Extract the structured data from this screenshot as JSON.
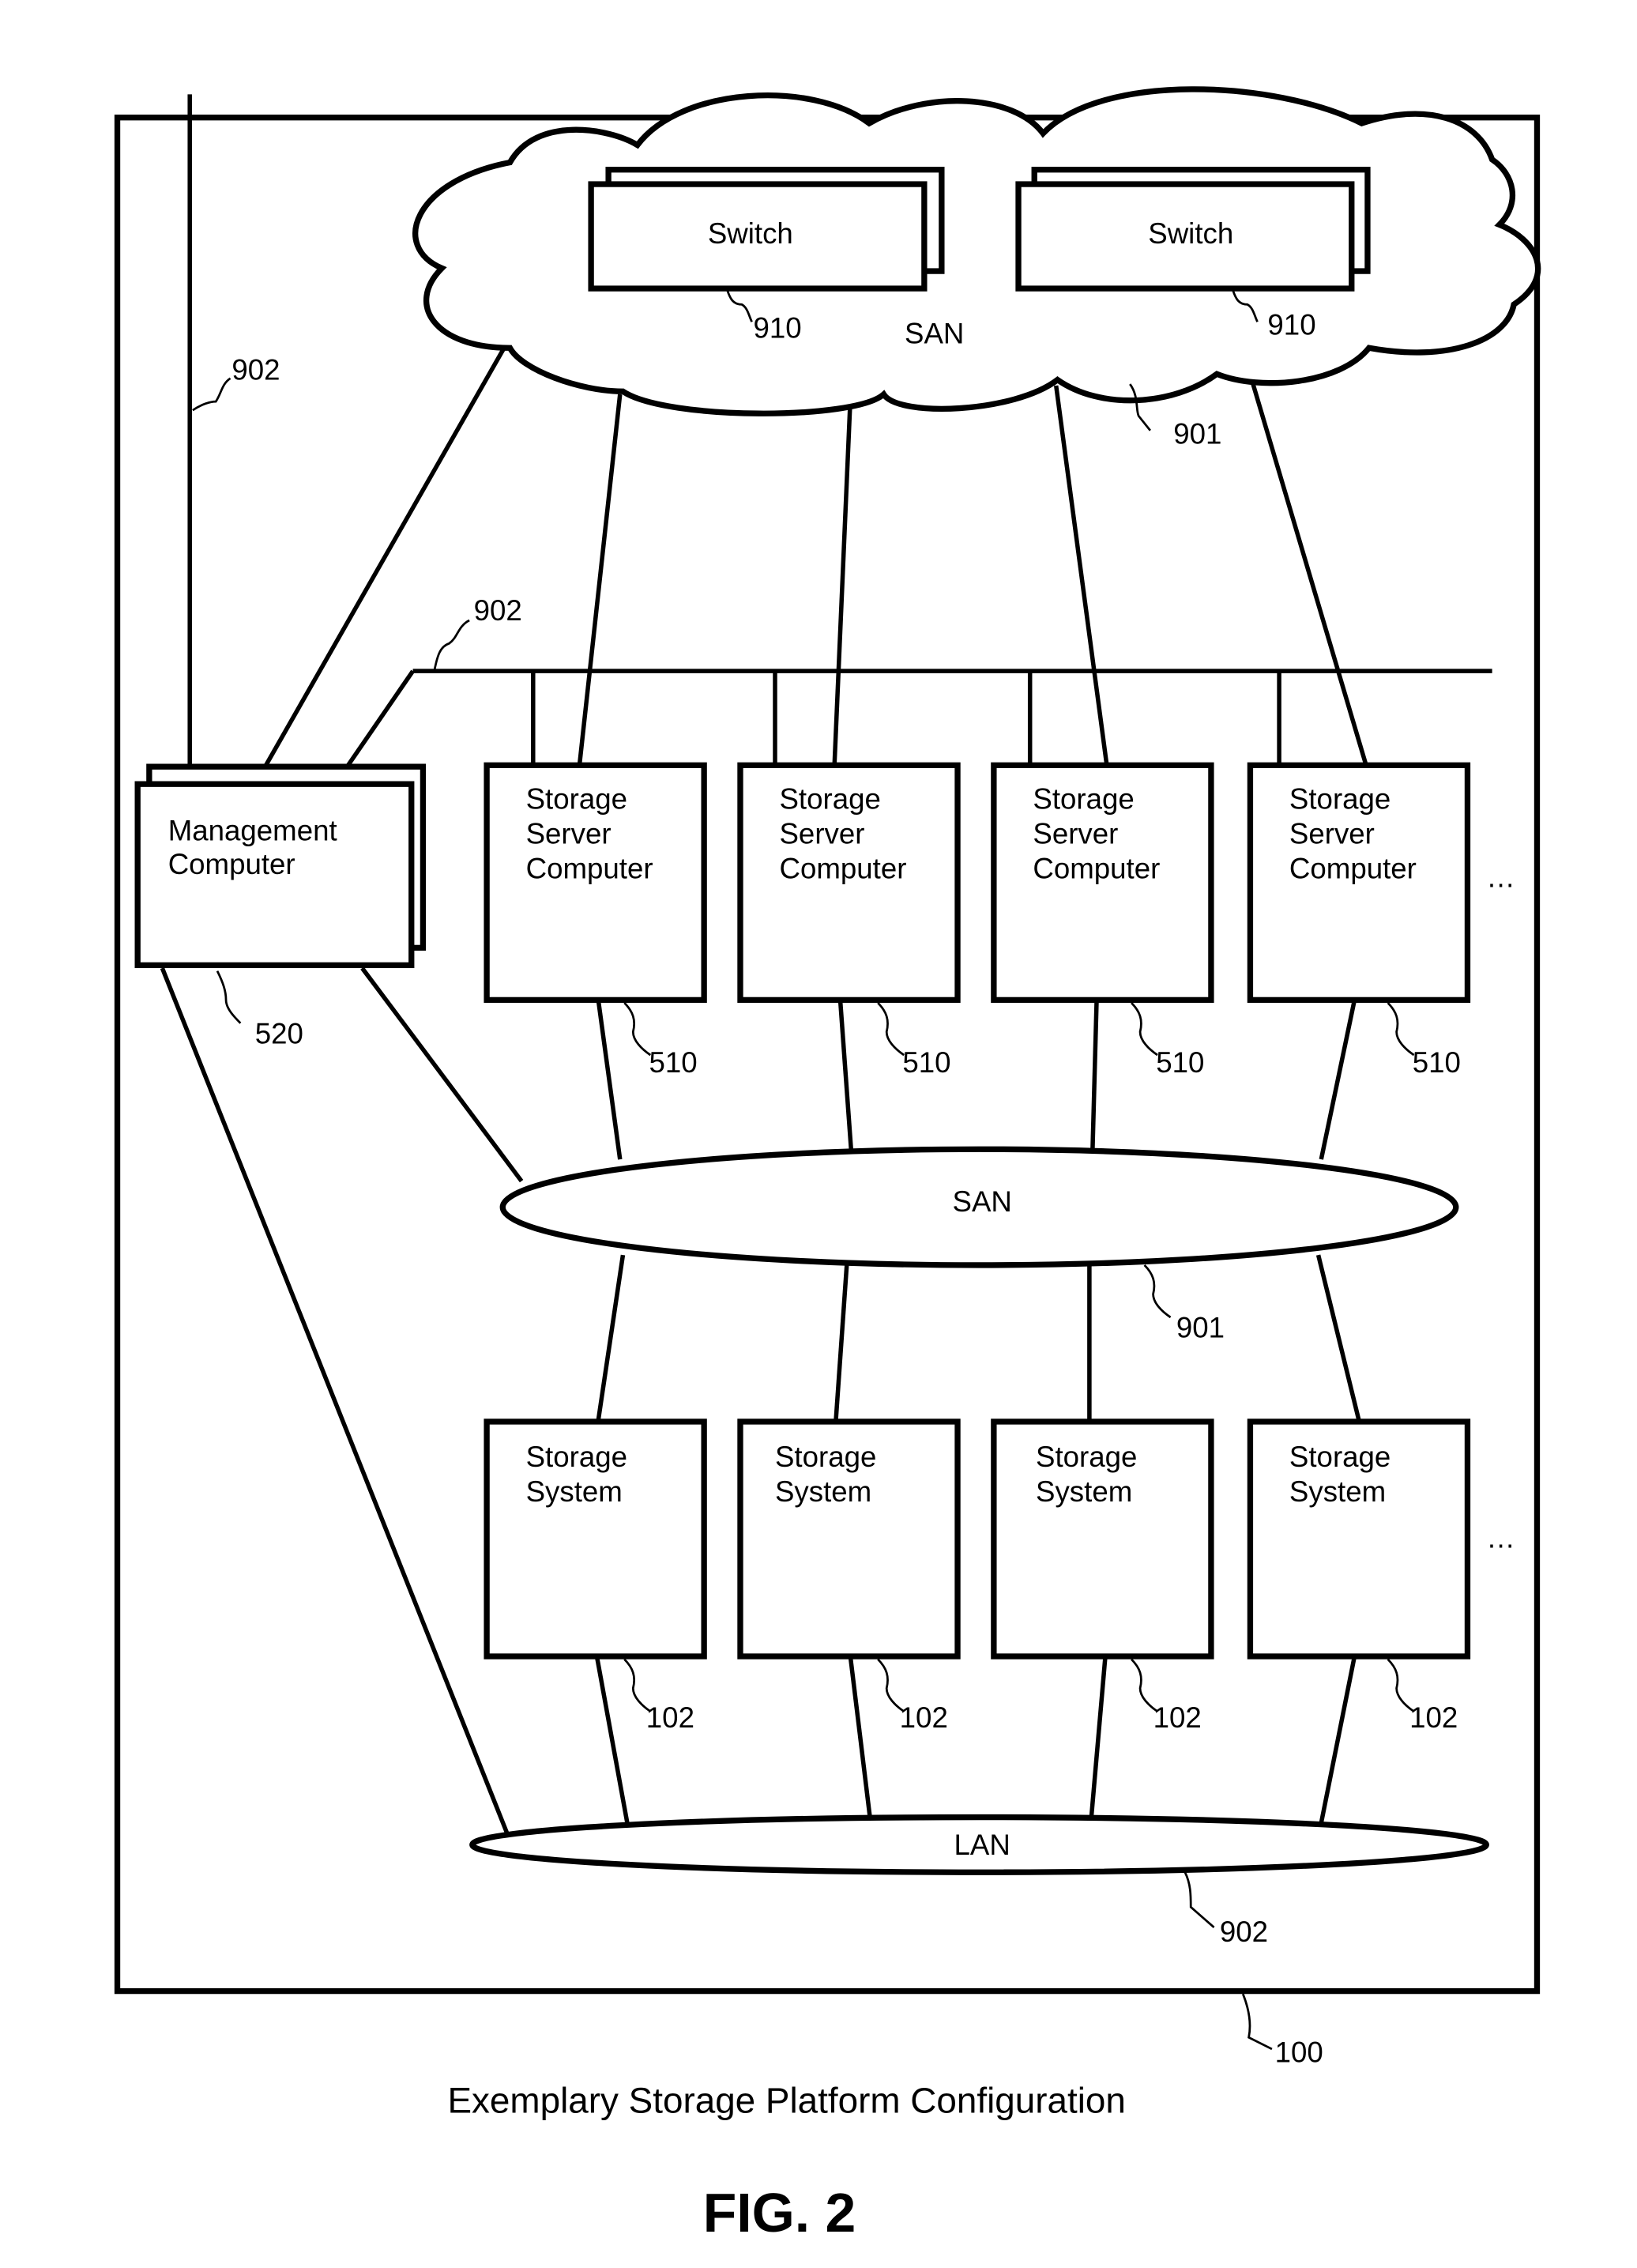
{
  "figure": {
    "number_label": "FIG. 2",
    "caption": "Exemplary Storage Platform Configuration",
    "platform_ref": "100"
  },
  "san_cloud": {
    "label": "SAN",
    "ref": "901",
    "switches": [
      {
        "label": "Switch",
        "ref": "910"
      },
      {
        "label": "Switch",
        "ref": "910"
      }
    ]
  },
  "lan_bus": {
    "ref_top": "902",
    "ref_mid": "902"
  },
  "management_computer": {
    "line1": "Management",
    "line2": "Computer",
    "ref": "520"
  },
  "storage_servers": [
    {
      "line1": "Storage",
      "line2": "Server",
      "line3": "Computer",
      "ref": "510"
    },
    {
      "line1": "Storage",
      "line2": "Server",
      "line3": "Computer",
      "ref": "510"
    },
    {
      "line1": "Storage",
      "line2": "Server",
      "line3": "Computer",
      "ref": "510"
    },
    {
      "line1": "Storage",
      "line2": "Server",
      "line3": "Computer",
      "ref": "510"
    }
  ],
  "san_ellipse": {
    "label": "SAN",
    "ref": "901"
  },
  "storage_systems": [
    {
      "line1": "Storage",
      "line2": "System",
      "ref": "102"
    },
    {
      "line1": "Storage",
      "line2": "System",
      "ref": "102"
    },
    {
      "line1": "Storage",
      "line2": "System",
      "ref": "102"
    },
    {
      "line1": "Storage",
      "line2": "System",
      "ref": "102"
    }
  ],
  "lan_ellipse": {
    "label": "LAN",
    "ref": "902"
  },
  "ellipsis": "…"
}
